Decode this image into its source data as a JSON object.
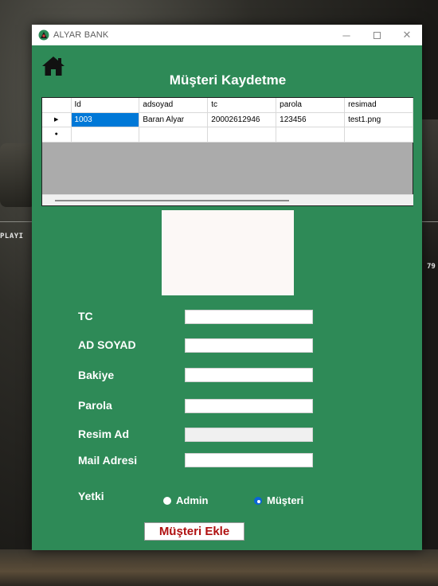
{
  "window": {
    "title": "ALYAR BANK"
  },
  "background": {
    "left_text": "PLAYI",
    "right_text": "79"
  },
  "form": {
    "title": "Müşteri Kaydetme",
    "grid": {
      "columns": [
        "Id",
        "adsoyad",
        "tc",
        "parola",
        "resimad"
      ],
      "rows": [
        {
          "indicator": "▶",
          "cells": [
            "1003",
            "Baran Alyar",
            "20002612946",
            "123456",
            "test1.png"
          ]
        }
      ],
      "new_row_indicator": "●"
    },
    "fields": {
      "tc": {
        "label": "TC",
        "value": ""
      },
      "adsoyad": {
        "label": "AD SOYAD",
        "value": ""
      },
      "bakiye": {
        "label": "Bakiye",
        "value": ""
      },
      "parola": {
        "label": "Parola",
        "value": ""
      },
      "resimad": {
        "label": "Resim Ad",
        "value": ""
      },
      "mail": {
        "label": "Mail Adresi",
        "value": ""
      }
    },
    "yetki": {
      "label": "Yetki",
      "options": [
        "Admin",
        "Müşteri"
      ],
      "selected": "Müşteri"
    },
    "submit_label": "Müşteri Ekle"
  },
  "colors": {
    "form_bg": "#2e8a57",
    "selected_cell": "#0078d7",
    "button_text": "#b01010"
  }
}
